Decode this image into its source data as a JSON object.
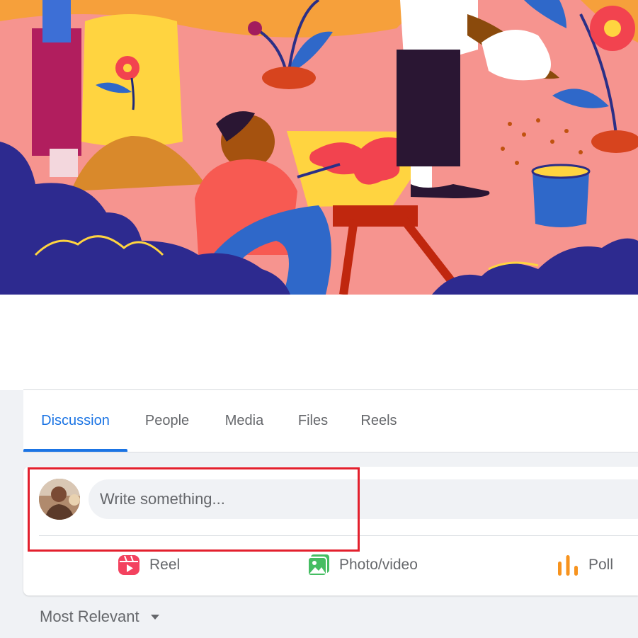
{
  "tabs": [
    {
      "label": "Discussion",
      "active": true
    },
    {
      "label": "People",
      "active": false
    },
    {
      "label": "Media",
      "active": false
    },
    {
      "label": "Files",
      "active": false
    },
    {
      "label": "Reels",
      "active": false
    }
  ],
  "composer": {
    "placeholder": "Write something...",
    "actions": [
      {
        "label": "Reel",
        "icon": "reel-icon",
        "color": "#f3425f"
      },
      {
        "label": "Photo/video",
        "icon": "photo-video-icon",
        "color": "#45bd62"
      },
      {
        "label": "Poll",
        "icon": "poll-icon",
        "color": "#f7931e"
      }
    ]
  },
  "sort": {
    "label": "Most Relevant",
    "icon": "caret-down-icon"
  },
  "colors": {
    "accent": "#1b74e4",
    "highlight": "#e3202d",
    "muted": "#65676b"
  }
}
